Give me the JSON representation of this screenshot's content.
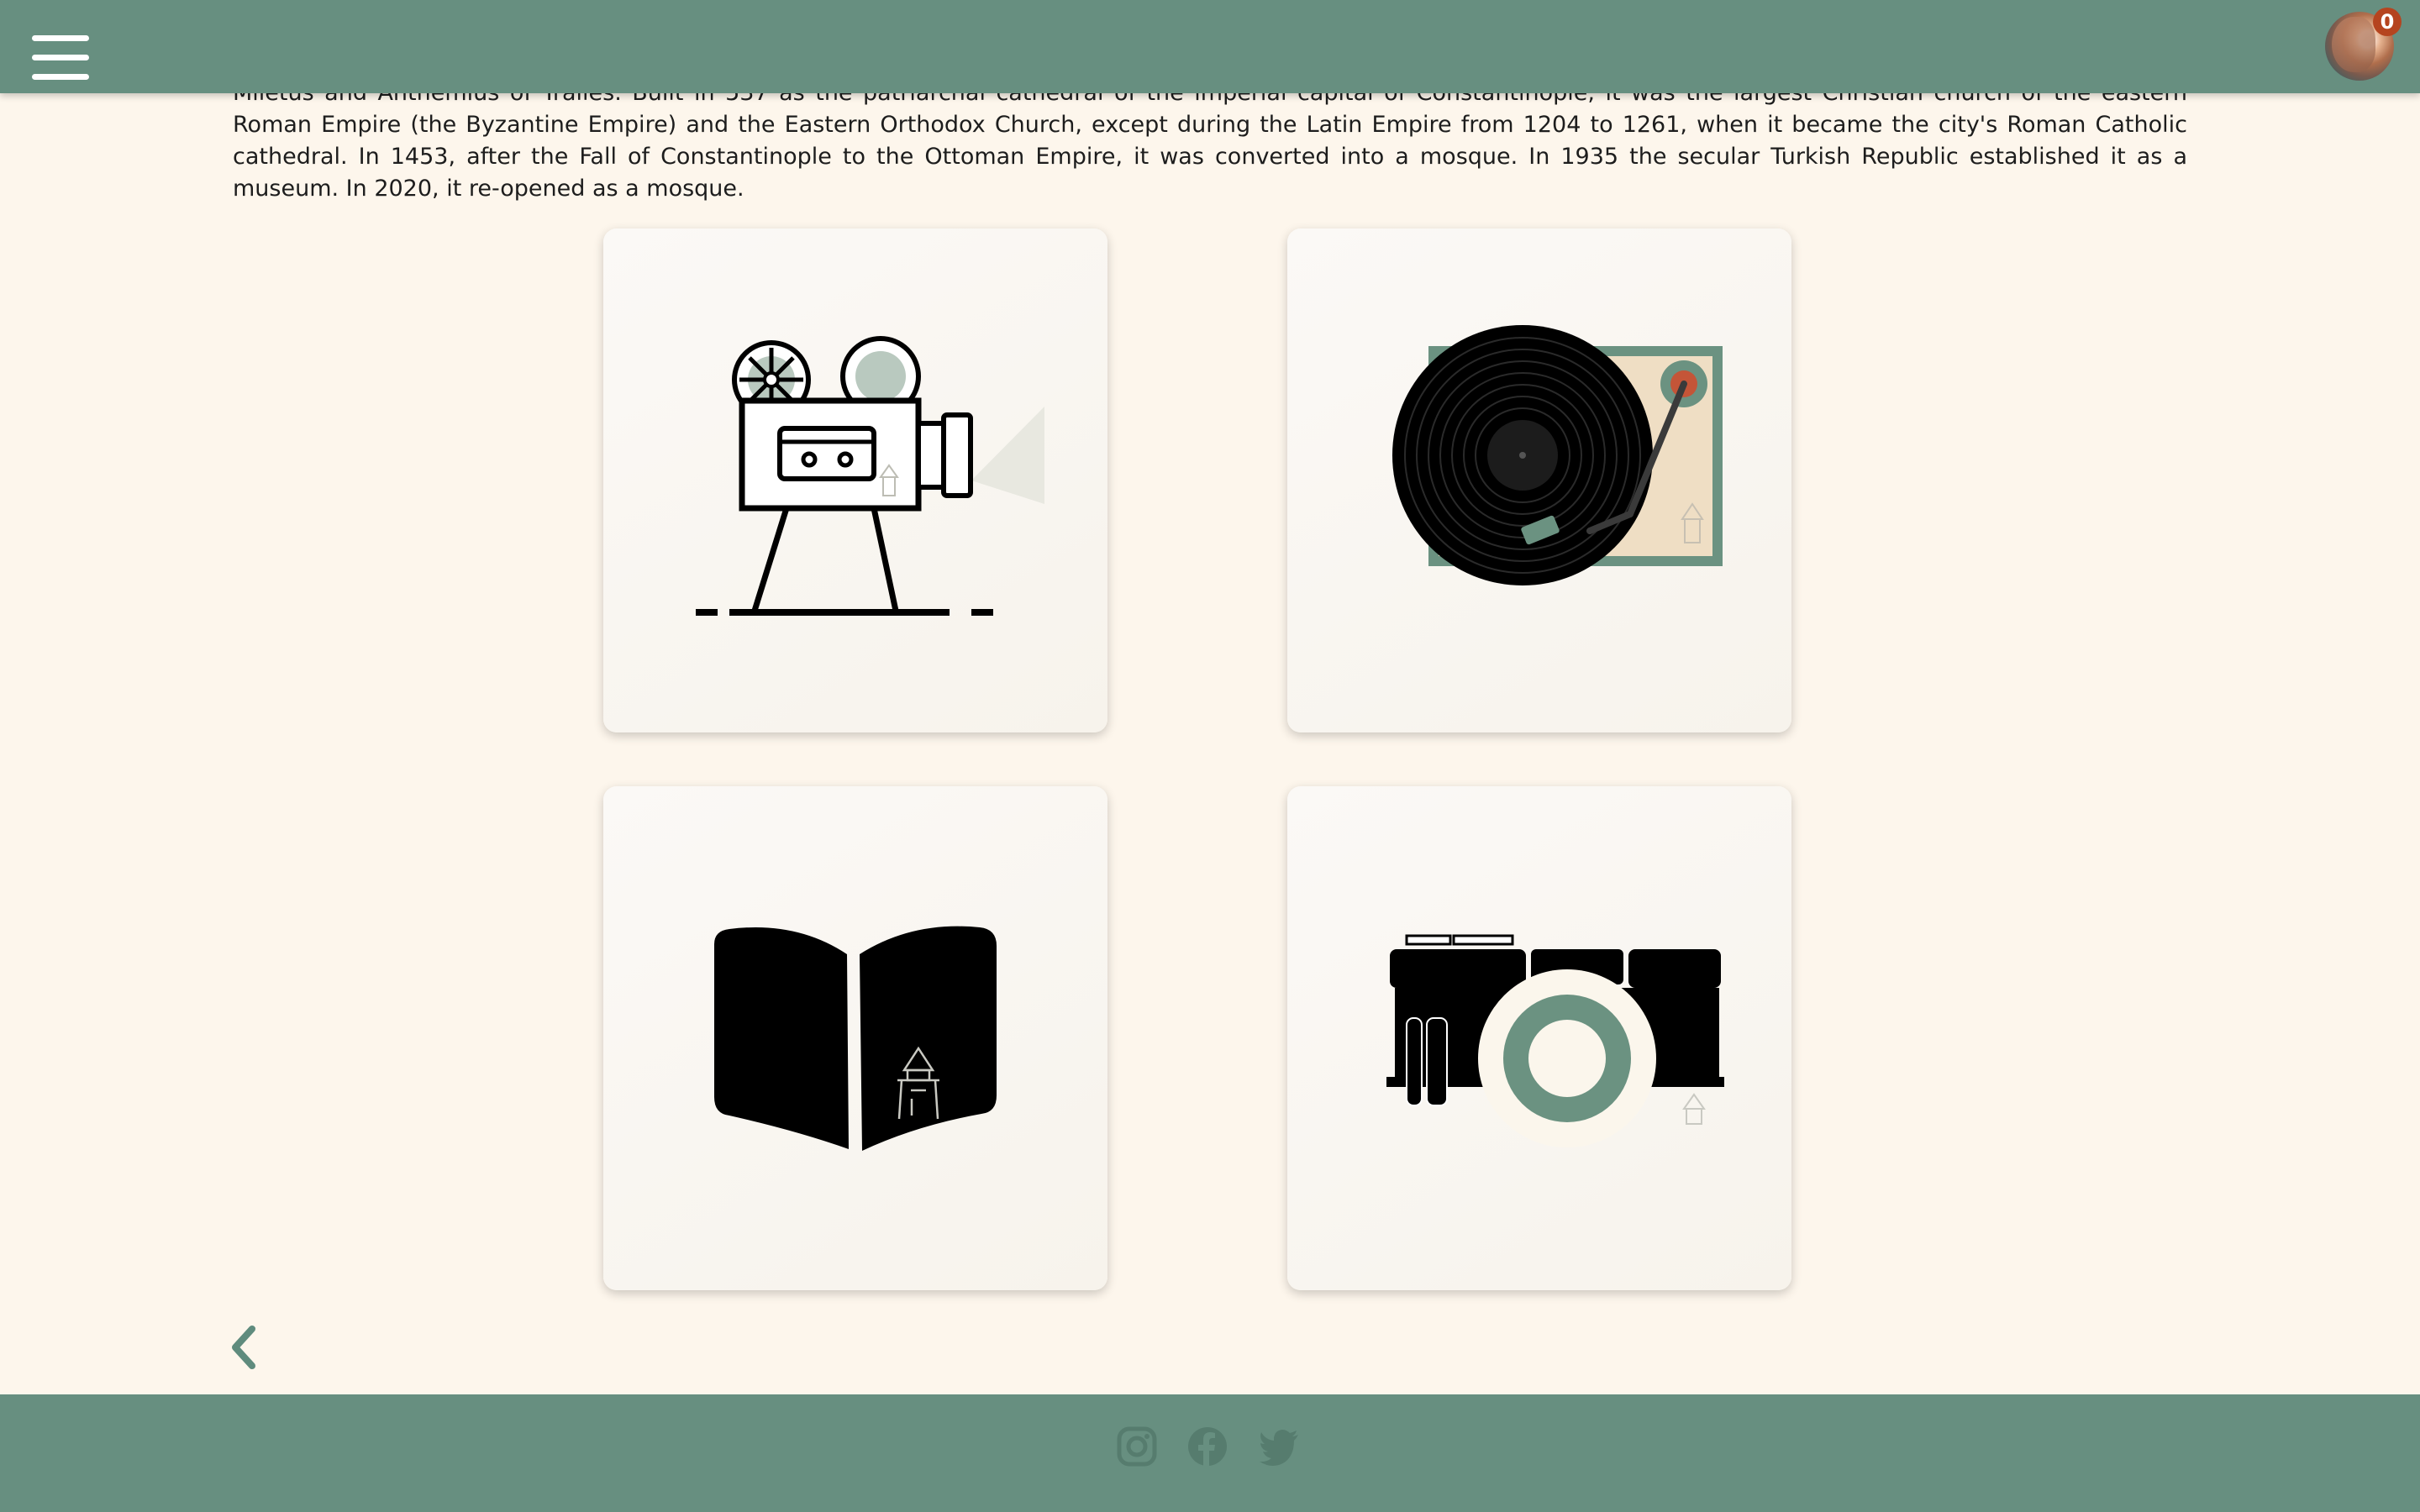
{
  "header": {
    "menu_icon": "hamburger-menu-icon",
    "avatar": "user-avatar",
    "cart_count": "0",
    "background_color": "#678f80"
  },
  "article": {
    "partial_top_line": "Miletus and Anthemius of Tralles. Built in 537 as the patriarchal cathedral of the imperial capital of Constantinople, it was the largest Christian church of the eastern Roman Empire (the Byzantine",
    "text": "Empire) and the Eastern Orthodox Church, except during the Latin Empire from 1204 to 1261, when it became the city's Roman Catholic cathedral. In 1453, after the Fall of Constantinople to the Ottoman Empire, it was converted into a mosque. In 1935 the secular Turkish Republic established it as a museum. In 2020, it re-opened as a mosque."
  },
  "cards": [
    {
      "icon": "film-projector-icon"
    },
    {
      "icon": "record-player-icon"
    },
    {
      "icon": "open-book-icon"
    },
    {
      "icon": "camera-icon"
    }
  ],
  "navigation": {
    "back_icon": "chevron-left-icon"
  },
  "footer": {
    "social": [
      "instagram-icon",
      "facebook-icon",
      "twitter-icon"
    ]
  },
  "colors": {
    "accent": "#678f80",
    "page_background": "#fdf6ec",
    "badge": "#b5441f"
  }
}
